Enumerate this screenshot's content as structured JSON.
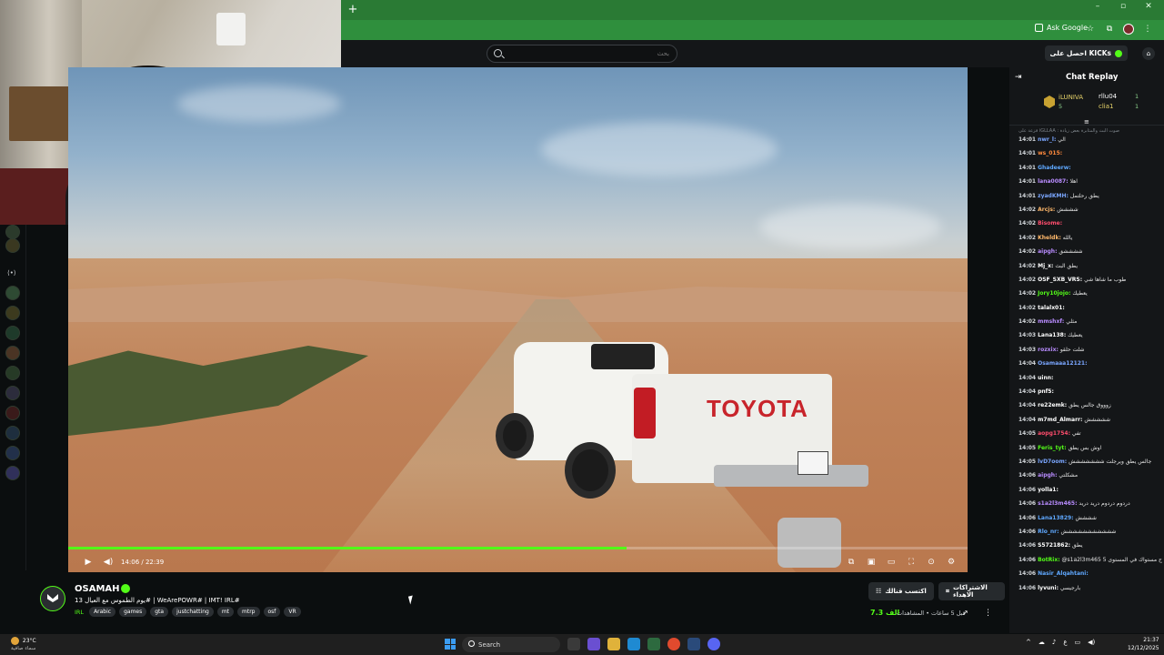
{
  "browser": {
    "new_tab": "+",
    "ask_google": "Ask Google",
    "win_min": "–",
    "win_max": "▫",
    "win_close": "✕"
  },
  "site": {
    "search_placeholder": "بحث",
    "kicks_button": "احصل على KICKs",
    "accent": "#53fc18"
  },
  "player": {
    "time": "14:06 / 22:39",
    "progress": 0.621
  },
  "chat": {
    "title": "Chat Replay",
    "pinned": {
      "name": "iLUNIVA",
      "count": "5",
      "right_top_name": "rllu04",
      "right_top_num": "1",
      "right_bottom_name": "clia1",
      "right_bottom_num": "1"
    },
    "system_top": "فزعة على iGLLAA : صوت البث والمثابرة بعض زيادة",
    "messages": [
      {
        "time": "14:01",
        "user": "nwr_l:",
        "color": "#7aa6ff",
        "text": "الي"
      },
      {
        "time": "14:01",
        "user": "ws_015:",
        "color": "#ff8a3d",
        "text": ""
      },
      {
        "time": "14:01",
        "user": "Ghadeerw:",
        "color": "#5fa8ff",
        "text": ""
      },
      {
        "time": "14:01",
        "user": "lana0087:",
        "color": "#b98cff",
        "text": "اهلا"
      },
      {
        "time": "14:01",
        "user": "zyadKMH:",
        "color": "#7aa6ff",
        "text": "يطق رحلتمل"
      },
      {
        "time": "14:02",
        "user": "Arcjs:",
        "color": "#ffb86b",
        "text": "شششش"
      },
      {
        "time": "14:02",
        "user": "Bisome:",
        "color": "#ff4d6d",
        "text": ""
      },
      {
        "time": "14:02",
        "user": "Kheldk:",
        "color": "#ffb86b",
        "text": "يالله"
      },
      {
        "time": "14:02",
        "user": "aipgh:",
        "color": "#b98cff",
        "text": "ششششق"
      },
      {
        "time": "14:02",
        "user": "Mj_x:",
        "color": "#ffffff",
        "text": "يطق البث"
      },
      {
        "time": "14:02",
        "user": "OSF_SXB_VRS:",
        "color": "#ffffff",
        "text": "طوب ما شاها شي"
      },
      {
        "time": "14:02",
        "user": "Jory10jojo:",
        "color": "#53fc18",
        "text": "يعطيك"
      },
      {
        "time": "14:02",
        "user": "talalx01:",
        "color": "#ffffff",
        "text": ""
      },
      {
        "time": "14:02",
        "user": "mmshxf:",
        "color": "#b98cff",
        "text": "مثلي"
      },
      {
        "time": "14:03",
        "user": "Lana138:",
        "color": "#ffffff",
        "text": "يعطيك"
      },
      {
        "time": "14:03",
        "user": "rozxix:",
        "color": "#b98cff",
        "text": "شلت حلقو"
      },
      {
        "time": "14:04",
        "user": "Osamaaa12121:",
        "color": "#7aa6ff",
        "text": ""
      },
      {
        "time": "14:04",
        "user": "uinn:",
        "color": "#ffffff",
        "text": ""
      },
      {
        "time": "14:04",
        "user": "pnf5:",
        "color": "#ffffff",
        "text": ""
      },
      {
        "time": "14:04",
        "user": "re22emk:",
        "color": "#ffffff",
        "text": "زوووق جالس يطق"
      },
      {
        "time": "14:04",
        "user": "m7md_Almarr:",
        "color": "#ffffff",
        "text": "ششششش"
      },
      {
        "time": "14:05",
        "user": "aopg1754:",
        "color": "#ff4d6d",
        "text": "تفي"
      },
      {
        "time": "14:05",
        "user": "Feris_tyt:",
        "color": "#53fc18",
        "text": "اوش بس يطق"
      },
      {
        "time": "14:05",
        "user": "lvD7oom:",
        "color": "#7aa6ff",
        "text": "جالس يطق ويرجلت ششششششش"
      },
      {
        "time": "14:06",
        "user": "aipgh:",
        "color": "#b98cff",
        "text": "مشكلتي"
      },
      {
        "time": "14:06",
        "user": "yolla1:",
        "color": "#ffffff",
        "text": ""
      },
      {
        "time": "14:06",
        "user": "s1a2l3m465:",
        "color": "#b98cff",
        "text": "دردوم دردوم دريد دريد"
      },
      {
        "time": "14:06",
        "user": "Lana13829:",
        "color": "#5fa8ff",
        "text": "شششش"
      },
      {
        "time": "14:06",
        "user": "Rlo_nr:",
        "color": "#5fa8ff",
        "text": "ششششششششششش"
      },
      {
        "time": "14:06",
        "user": "S5721862:",
        "color": "#ffffff",
        "text": "يطق"
      },
      {
        "time": "14:06",
        "user": "BotRix:",
        "color": "#53fc18",
        "text": "@s1a2l3m465 انت براح مستواك في المستوى 5"
      },
      {
        "time": "14:06",
        "user": "Nasir_Alqahtani:",
        "color": "#5fa8ff",
        "text": ""
      },
      {
        "time": "14:06",
        "user": "lyvuni:",
        "color": "#ffffff",
        "text": "بارجيسي"
      }
    ]
  },
  "stream": {
    "channel": "OSAMAH",
    "title": "يوم الطموس مع العيال 13# | WeArePOWR# | IMT! IRL#",
    "category": "IRL",
    "tags": [
      "Arabic",
      "games",
      "gta",
      "justchatting",
      "mt",
      "mtrp",
      "osf",
      "VR"
    ],
    "subscribe_button": "اكتسب قنالك",
    "gift_button": "الاشتراكات الاهداء",
    "viewers": "7.3 الف",
    "viewer_label": "قبل 5 ساعات • المشاهدات"
  },
  "taskbar": {
    "weather_temp": "23°C",
    "weather_desc": "سماء صافية",
    "search": "Search",
    "time": "21:37",
    "date": "12/12/2025",
    "lang": "ع"
  }
}
